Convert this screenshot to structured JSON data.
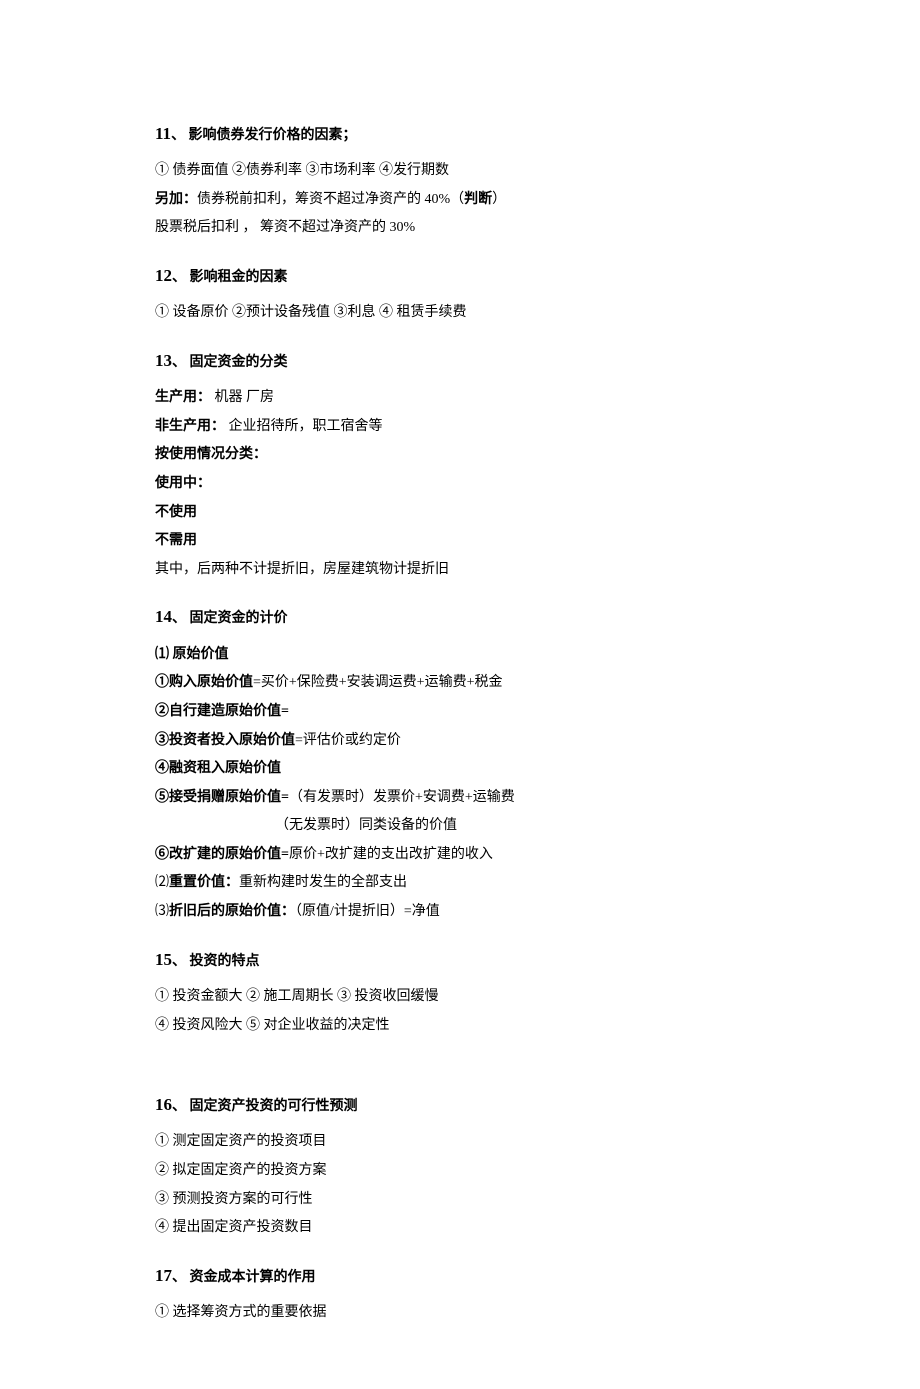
{
  "s11": {
    "num": "11",
    "title": "、 影响债券发行价格的因素；",
    "line1": "①   债券面值   ②债券利率   ③市场利率   ④发行期数",
    "line2a": "另加：",
    "line2b": "债券税前扣利，筹资不超过净资产的 40%（",
    "line2c": "判断",
    "line2d": "）",
    "line3": "股票税后扣利  ，  筹资不超过净资产的 30%"
  },
  "s12": {
    "num": "12",
    "title": "、 影响租金的因素",
    "line1": "①   设备原价  ②预计设备残值  ③利息  ④ 租赁手续费"
  },
  "s13": {
    "num": "13",
    "title": "、 固定资金的分类",
    "line1a": "生产用：",
    "line1b": " 机器   厂房",
    "line2a": "非生产用：",
    "line2b": "   企业招待所，职工宿舍等",
    "line3": "按使用情况分类：",
    "line4": "使用中：",
    "line5": "不使用",
    "line6": "不需用",
    "line7": "其中，后两种不计提折旧，房屋建筑物计提折旧"
  },
  "s14": {
    "num": "14",
    "title": "、 固定资金的计价",
    "line1": "⑴ 原始价值",
    "line2a": "①购入原始价值",
    "line2b": "=买价+保险费+安装调运费+运输费+税金",
    "line3": "②自行建造原始价值=",
    "line4a": "③投资者投入原始价值",
    "line4b": "=评估价或约定价",
    "line5": "④融资租入原始价值",
    "line6a": "⑤接受捐赠原始价值=",
    "line6b": "（有发票时）发票价+安调费+运输费",
    "line7": "（无发票时）同类设备的价值",
    "line8a": "⑥改扩建的原始价值=",
    "line8b": "原价+改扩建的支出改扩建的收入",
    "line9a": "⑵",
    "line9b": "重置价值：",
    "line9c": "重新构建时发生的全部支出",
    "line10a": "⑶",
    "line10b": "折旧后的原始价值：",
    "line10c": "（原值/计提折旧）=净值"
  },
  "s15": {
    "num": "15",
    "title": "、 投资的特点",
    "line1": "①   投资金额大  ②  施工周期长  ③  投资收回缓慢",
    "line2": "④  投资风险大   ⑤  对企业收益的决定性"
  },
  "s16": {
    "num": "16",
    "title": "、 固定资产投资的可行性预测",
    "line1": "①  测定固定资产的投资项目",
    "line2": "②  拟定固定资产的投资方案",
    "line3": "③  预测投资方案的可行性",
    "line4": "④  提出固定资产投资数目"
  },
  "s17": {
    "num": "17",
    "title": "、 资金成本计算的作用",
    "line1": "①  选择筹资方式的重要依据"
  }
}
